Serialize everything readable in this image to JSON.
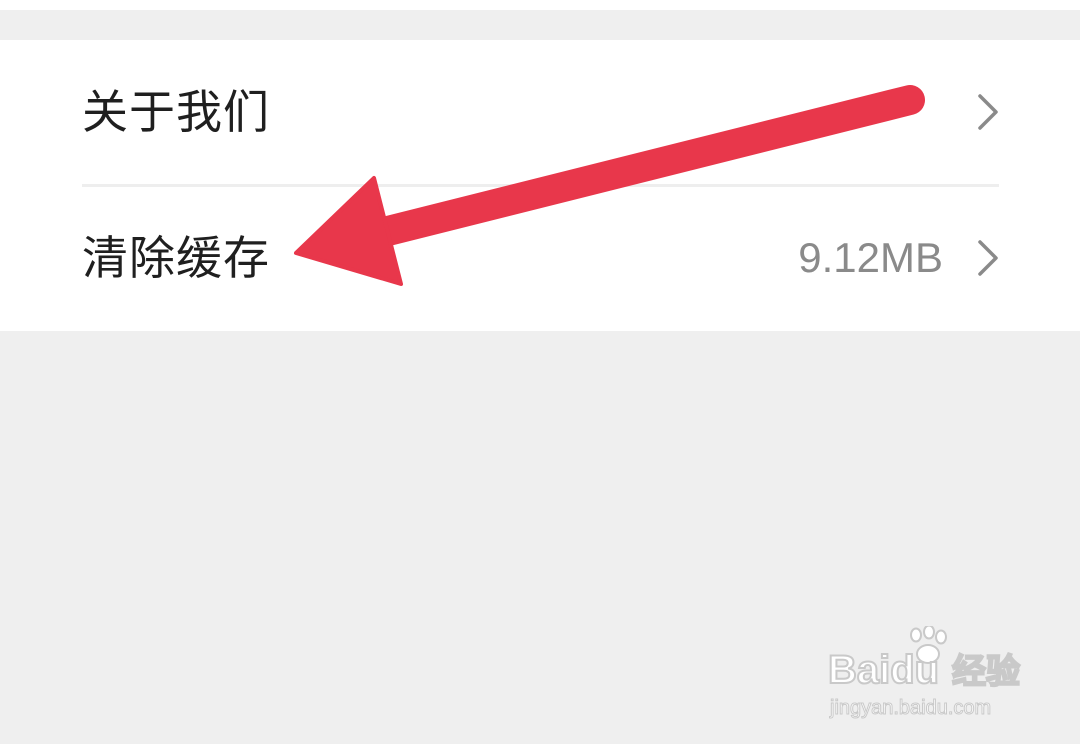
{
  "settings": {
    "items": [
      {
        "label": "关于我们",
        "value": "",
        "icon": "chevron-right-icon"
      },
      {
        "label": "清除缓存",
        "value": "9.12MB",
        "icon": "chevron-right-icon"
      }
    ]
  },
  "annotation": {
    "icon": "arrow-annotation-icon",
    "color": "#e8374b"
  },
  "watermark": {
    "brand": "Baidu",
    "sub": "经验",
    "url": "jingyan.baidu.com"
  },
  "colors": {
    "background": "#efefef",
    "surface": "#ffffff",
    "text": "#1f1f1f",
    "secondary_text": "#8a8a8a",
    "divider": "#eeeeee"
  }
}
